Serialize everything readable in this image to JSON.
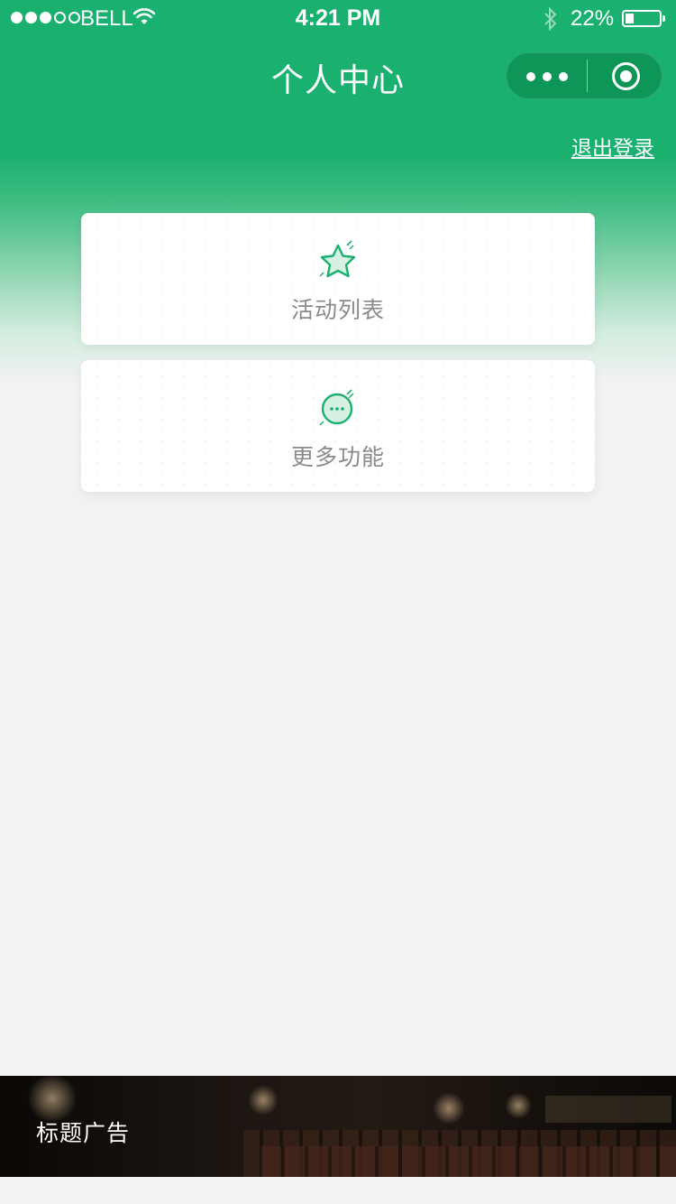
{
  "status_bar": {
    "carrier": "BELL",
    "time": "4:21 PM",
    "battery_percent": "22%",
    "signal_strength": 3,
    "signal_max": 5
  },
  "nav": {
    "title": "个人中心",
    "more_icon": "more-dots-icon",
    "close_icon": "target-close-icon"
  },
  "header": {
    "logout_label": "退出登录"
  },
  "menu": {
    "items": [
      {
        "label": "活动列表",
        "icon": "star-icon"
      },
      {
        "label": "更多功能",
        "icon": "chat-bubble-icon"
      }
    ]
  },
  "ad": {
    "title": "标题广告"
  },
  "colors": {
    "brand_green": "#1ab06f",
    "card_text": "#8a8a8a",
    "page_bg": "#f2f2f2"
  }
}
